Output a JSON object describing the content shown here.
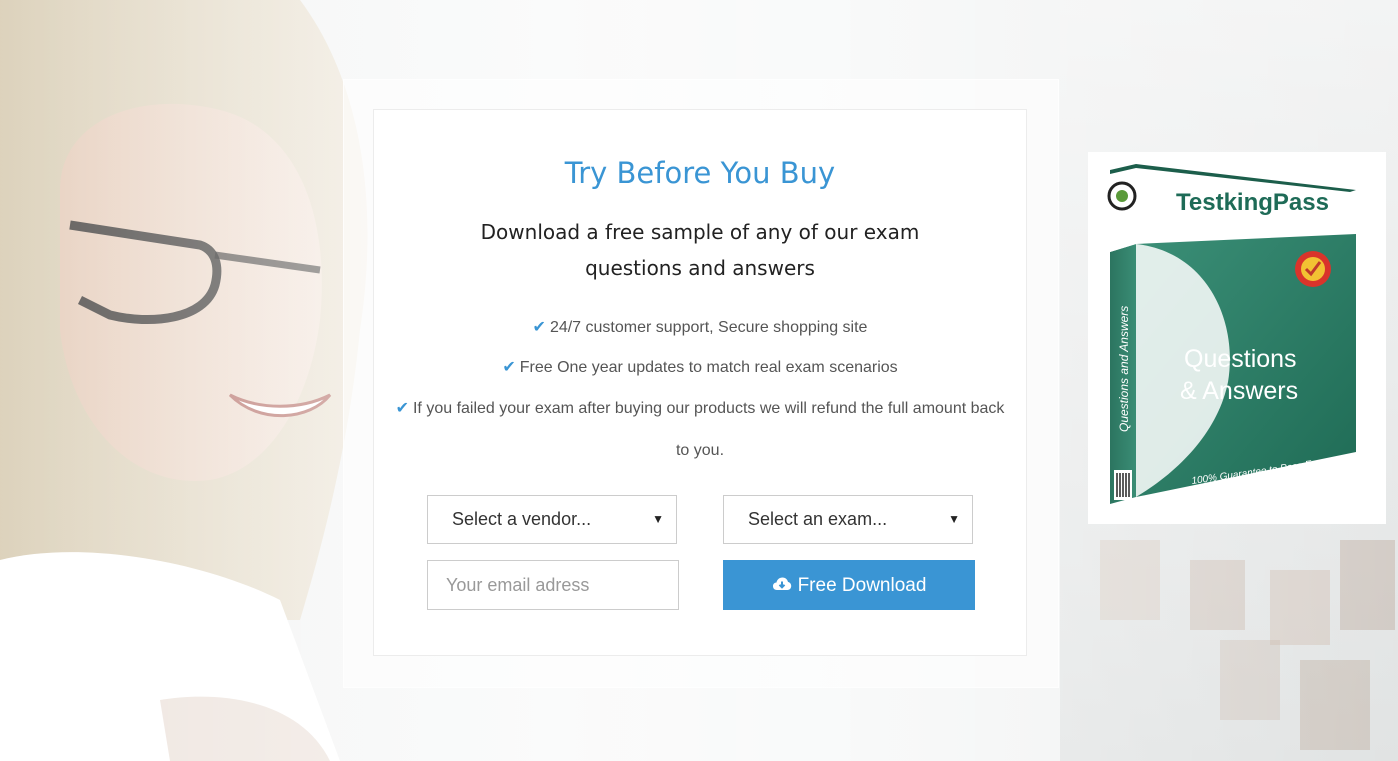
{
  "promo": {
    "title": "Try Before You Buy",
    "subtitle": "Download a free sample of any of our exam questions and answers",
    "features": [
      "24/7 customer support, Secure shopping site",
      "Free One year updates to match real exam scenarios",
      "If you failed your exam after buying our products we will refund the full amount back to you."
    ]
  },
  "form": {
    "vendor_select": "Select a vendor...",
    "exam_select": "Select an exam...",
    "email_placeholder": "Your email adress",
    "download_label": "Free Download"
  },
  "product": {
    "brand": "TestkingPass",
    "side_label": "Questions and Answers",
    "headline_line1": "Questions",
    "headline_line2": "& Answers",
    "guarantee": "100% Guarantee to Pass Exam"
  },
  "colors": {
    "accent": "#3a95d4",
    "box_green": "#2e7a63"
  },
  "icons": {
    "check": "check-icon",
    "cloud": "cloud-download-icon",
    "dropdown": "chevron-down-icon"
  }
}
